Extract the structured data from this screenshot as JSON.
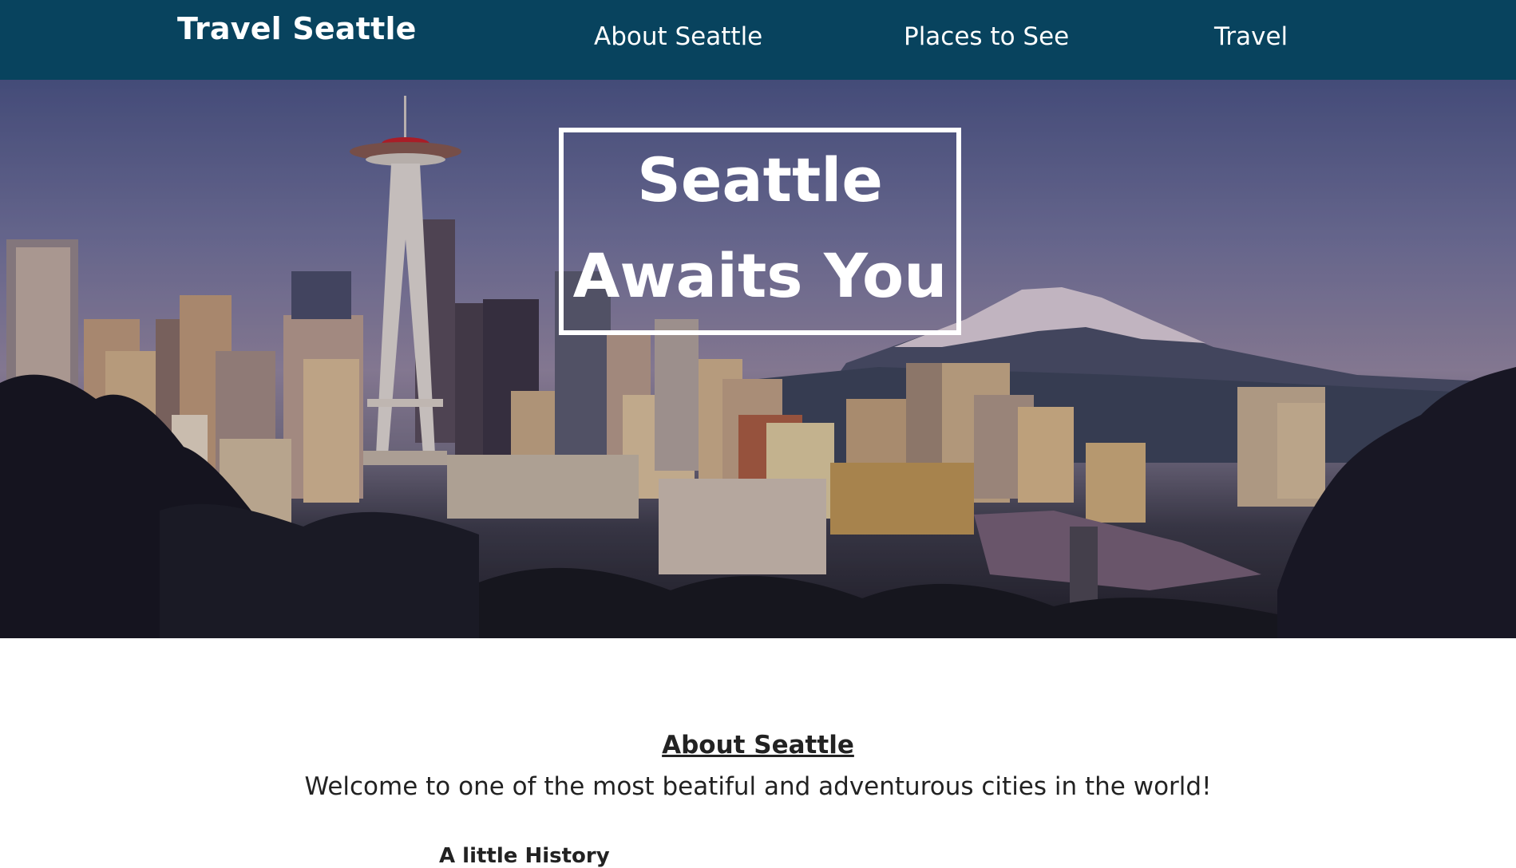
{
  "navbar": {
    "brand": "Travel Seattle",
    "links": [
      {
        "label": "About Seattle"
      },
      {
        "label": "Places to See"
      },
      {
        "label": "Travel"
      }
    ],
    "background": "#08435e"
  },
  "hero": {
    "title_line1": "Seattle",
    "title_line2": "Awaits You"
  },
  "about": {
    "heading": "About Seattle",
    "welcome": "Welcome to one of the most beatiful and adventurous cities in the world!",
    "subheading": "A little History"
  }
}
